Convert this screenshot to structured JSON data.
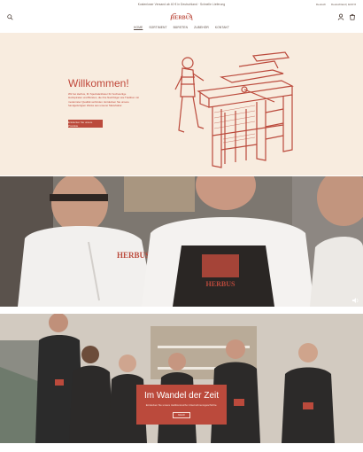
{
  "topbar": {
    "promo": "Kostenloser Versand ab 40 € in Deutschland · Schnelle Lieferung",
    "language": "Deutsch",
    "currency": "Deutschland | EUR €"
  },
  "header": {
    "logo_text": "HERBUS",
    "search_icon": "search-icon",
    "account_icon": "account-icon",
    "cart_icon": "cart-icon"
  },
  "nav": {
    "items": [
      {
        "label": "HOME"
      },
      {
        "label": "SORTIMENT"
      },
      {
        "label": "BÜRSTEN"
      },
      {
        "label": "ZUBEHÖR"
      },
      {
        "label": "KONTAKT"
      }
    ]
  },
  "hero": {
    "title": "Willkommen!",
    "description": "Wir bei Herbus, Ihr Spezialanbieter für hochwertige Holzspiralen und Bürsten, die ihre Nachfolger wie Tradition mit modernster Qualität verbinden. Entdecken Sie unsere handgefertigten Werke aus unserer Manufaktur.",
    "button": "Entdecken Sie unsere Produkte"
  },
  "video": {
    "mute_icon": "speaker-icon"
  },
  "banner": {
    "title": "Im Wandel der Zeit",
    "subtitle": "Entdecken Sie unsere traditionsreiche Unternehmensgeschichte.",
    "button": "MEHR"
  },
  "colors": {
    "accent": "#bb4a3c",
    "cream": "#f8ecdf"
  }
}
